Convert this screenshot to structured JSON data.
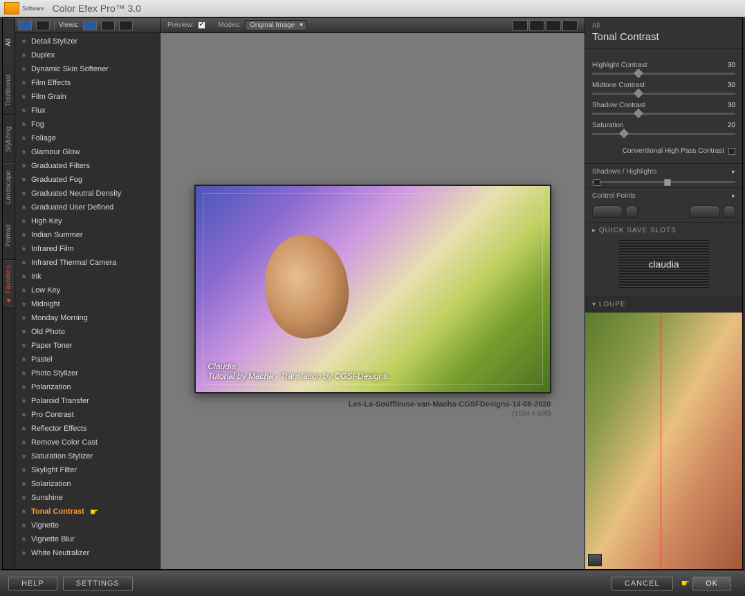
{
  "app": {
    "vendor": "nik",
    "vendor_sub": "Software",
    "title": "Color Efex Pro™ 3.0"
  },
  "toolbar": {
    "views": "Views:",
    "preview": "Preview:",
    "modes": "Modes:",
    "mode_selected": "Original Image"
  },
  "vtabs": [
    "All",
    "Traditional",
    "Stylizing",
    "Landscape",
    "Portrait",
    "Favorites"
  ],
  "filters": [
    "Detail Stylizer",
    "Duplex",
    "Dynamic Skin Softener",
    "Film Effects",
    "Film Grain",
    "Flux",
    "Fog",
    "Foliage",
    "Glamour Glow",
    "Graduated Filters",
    "Graduated Fog",
    "Graduated Neutral Density",
    "Graduated User Defined",
    "High Key",
    "Indian Summer",
    "Infrared Film",
    "Infrared Thermal Camera",
    "Ink",
    "Low Key",
    "Midnight",
    "Monday Morning",
    "Old Photo",
    "Paper Toner",
    "Pastel",
    "Photo Stylizer",
    "Polarization",
    "Polaroid Transfer",
    "Pro Contrast",
    "Reflector Effects",
    "Remove Color Cast",
    "Saturation Stylizer",
    "Skylight Filter",
    "Solarization",
    "Sunshine",
    "Tonal Contrast",
    "Vignette",
    "Vignette Blur",
    "White Neutralizer"
  ],
  "selected_filter": "Tonal Contrast",
  "image": {
    "credit1": "Claudia",
    "credit2": "Tutorial by Macha  -  Translation by CGSFDesigns.",
    "caption": "Les-La-Souffleuse-van-Macha-CGSFDesigns-14-08-2020",
    "dimensions": "(1024 x 600)"
  },
  "panel": {
    "all": "All",
    "title": "Tonal Contrast",
    "sliders": [
      {
        "label": "Highlight Contrast",
        "value": "30",
        "pct": 30
      },
      {
        "label": "Midtone Contrast",
        "value": "30",
        "pct": 30
      },
      {
        "label": "Shadow Contrast",
        "value": "30",
        "pct": 30
      },
      {
        "label": "Saturation",
        "value": "20",
        "pct": 20
      }
    ],
    "checkbox": "Conventional High Pass Contrast",
    "shadows": "Shadows / Highlights",
    "control": "Control Points",
    "quicksave": "QUICK SAVE SLOTS",
    "loupe": "LOUPE",
    "thumb_label": "claudia"
  },
  "footer": {
    "help": "HELP",
    "settings": "SETTINGS",
    "cancel": "CANCEL",
    "ok": "OK"
  }
}
